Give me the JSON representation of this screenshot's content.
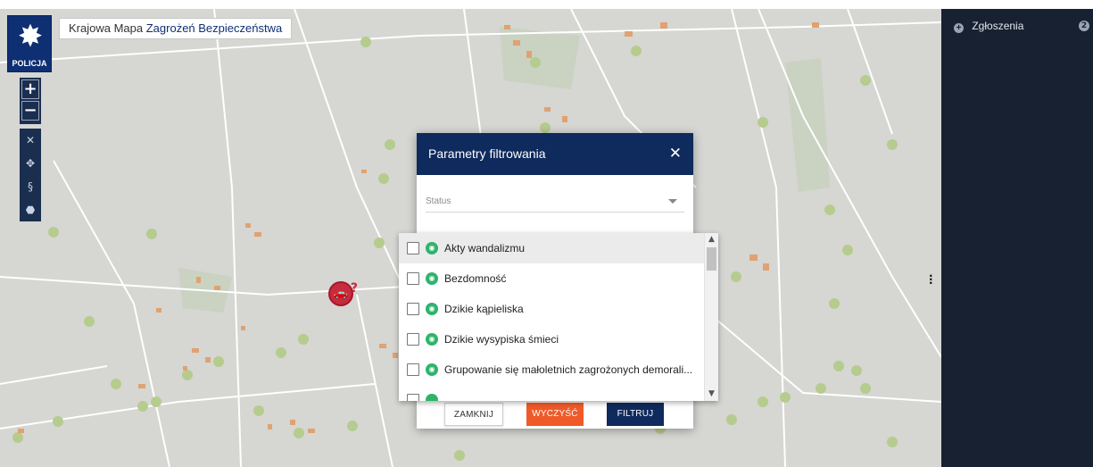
{
  "colors": {
    "map_bg": "#d6d6d3",
    "road": "#ffffff",
    "tree": "#b5cc8e",
    "building": "#e0a272",
    "field": "#c2cfb8",
    "dialog_header": "#0f2a5c",
    "clear_button": "#f05a28",
    "filter_button": "#0f2a5c",
    "side_panel": "#172131",
    "category_icon": "#2eb46a",
    "marker": "#c62b3e"
  },
  "logo": {
    "text": "POLICJA",
    "icon": "police-star-icon"
  },
  "map_title": {
    "prefix": "Krajowa Mapa",
    "emphasis": "Zagrożeń Bezpieczeństwa"
  },
  "zoom": {
    "in_label": "+",
    "out_label": "−"
  },
  "tools": [
    {
      "name": "fullscreen-icon",
      "glyph": "✕"
    },
    {
      "name": "locate-icon",
      "glyph": "✥"
    },
    {
      "name": "paragraph-icon",
      "glyph": "§"
    },
    {
      "name": "tag-icon",
      "glyph": "⬣"
    }
  ],
  "marker": {
    "icon": "car-incident-icon",
    "glyph": "🚗",
    "badge": "?"
  },
  "side_panel": {
    "title": "Zgłoszenia",
    "count": "2"
  },
  "dialog": {
    "title": "Parametry filtrowania",
    "close_glyph": "✕",
    "status_placeholder": "Status",
    "options": [
      {
        "label": "Akty wandalizmu",
        "icon": "vandalism-icon",
        "checked": false
      },
      {
        "label": "Bezdomność",
        "icon": "homelessness-icon",
        "checked": false
      },
      {
        "label": "Dzikie kąpieliska",
        "icon": "swimming-icon",
        "checked": false
      },
      {
        "label": "Dzikie wysypiska śmieci",
        "icon": "waste-dump-icon",
        "checked": false
      },
      {
        "label": "Grupowanie się małoletnich zagrożonych demorali...",
        "icon": "youth-group-icon",
        "checked": false
      }
    ],
    "buttons": {
      "close": "ZAMKNIJ",
      "clear": "WYCZYŚĆ",
      "filter": "FILTRUJ"
    }
  }
}
